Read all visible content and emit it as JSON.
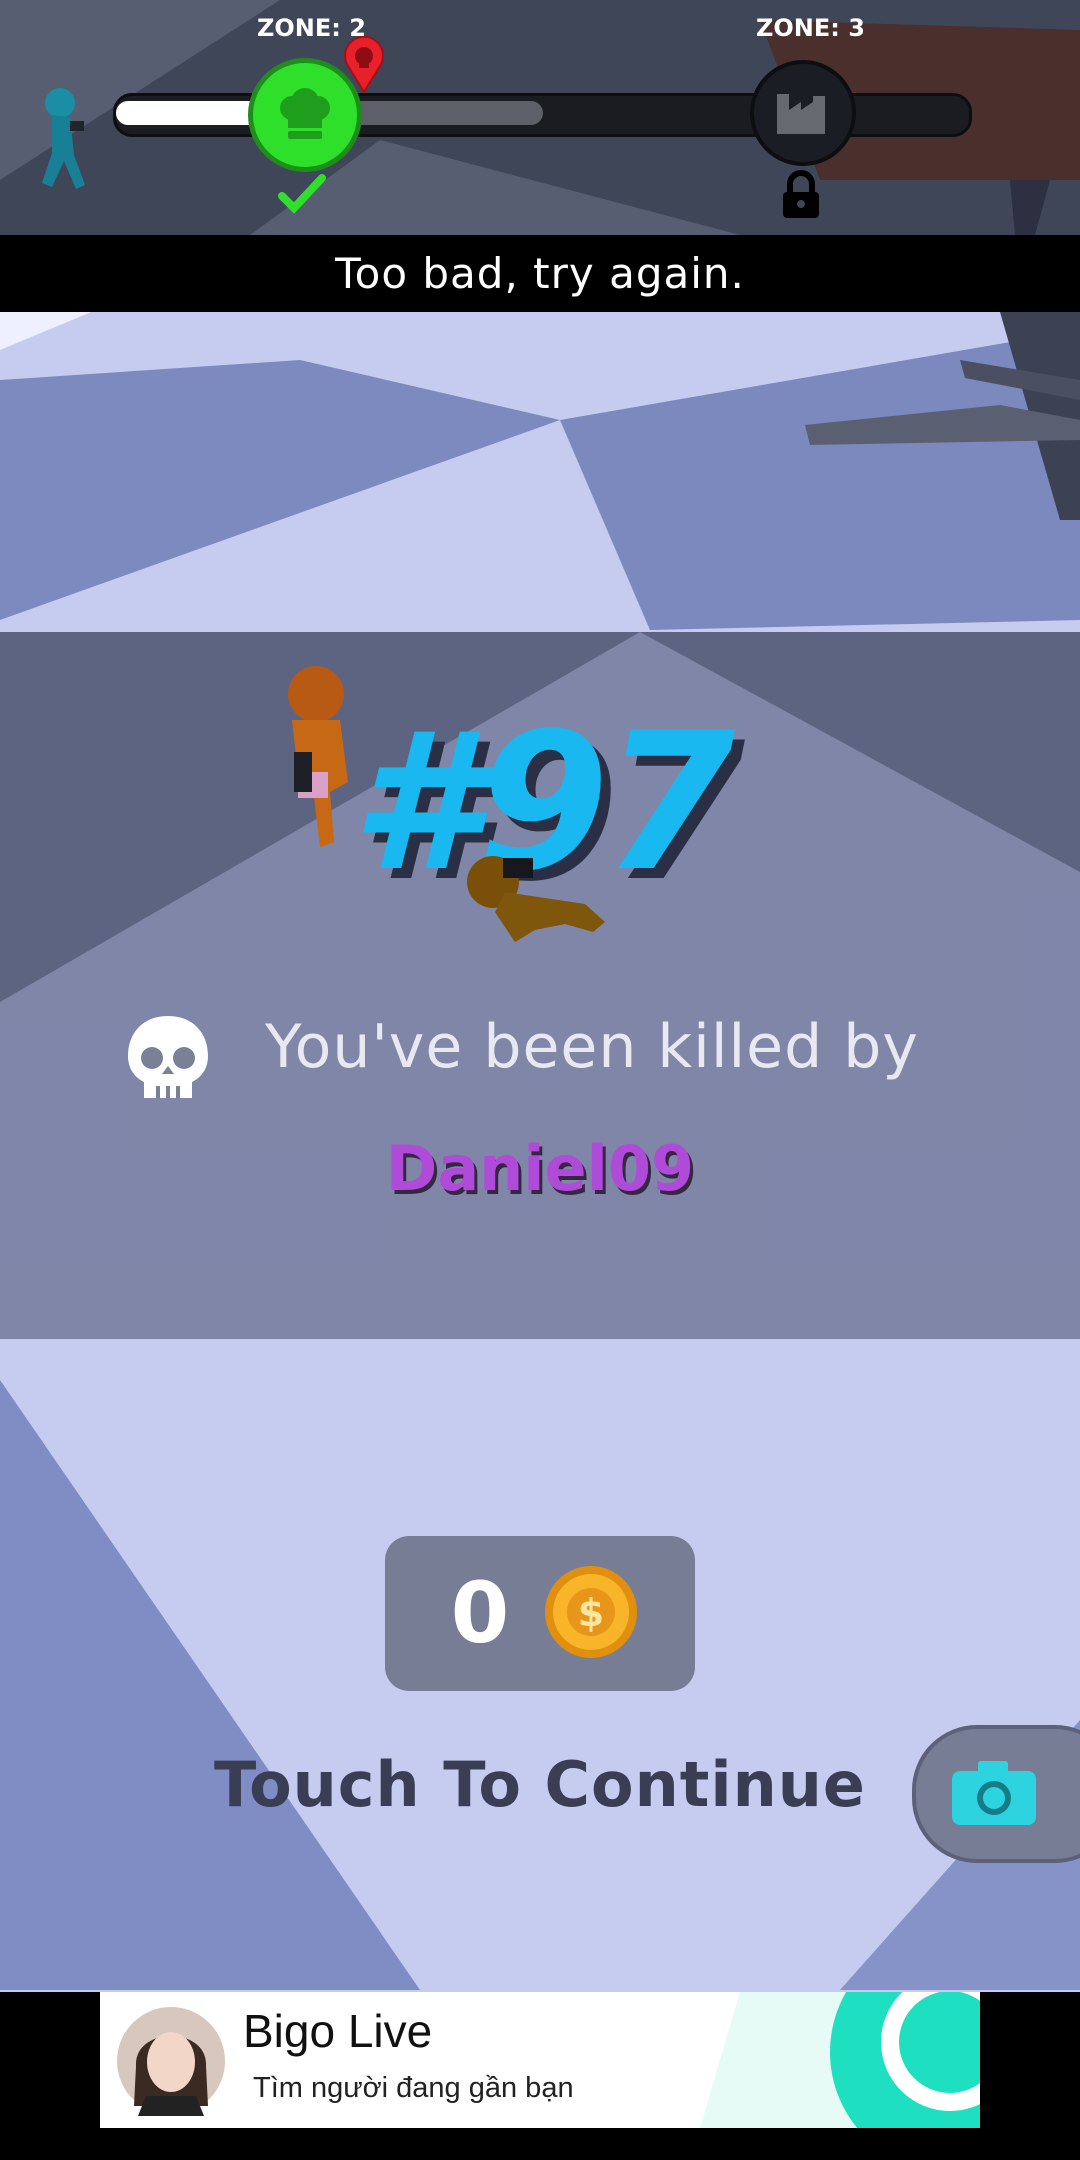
{
  "hud": {
    "zone_current_label": "ZONE: 2",
    "zone_next_label": "ZONE: 3",
    "progress_white": 0.26,
    "progress_grey": 0.5,
    "status_message": "Too bad, try again."
  },
  "result": {
    "rank": "#97",
    "killed_by_text": "You've been killed by",
    "killer_name": "Daniel09"
  },
  "reward": {
    "coins": "0"
  },
  "continue_label": "Touch To Continue",
  "ad": {
    "title": "Bigo Live",
    "subtitle": "Tìm người đang gần bạn"
  },
  "icons": {
    "current_zone": "chef-hat-icon",
    "next_zone": "factory-icon",
    "completed": "check-icon",
    "locked": "lock-icon",
    "death_marker": "skull-pin-icon",
    "killed": "skull-icon",
    "coin": "coin-icon",
    "camera": "camera-icon"
  },
  "colors": {
    "rank": "#19b8f0",
    "killer": "#b04ad8",
    "node_active": "#2ee02a",
    "marker": "#e8202a"
  }
}
